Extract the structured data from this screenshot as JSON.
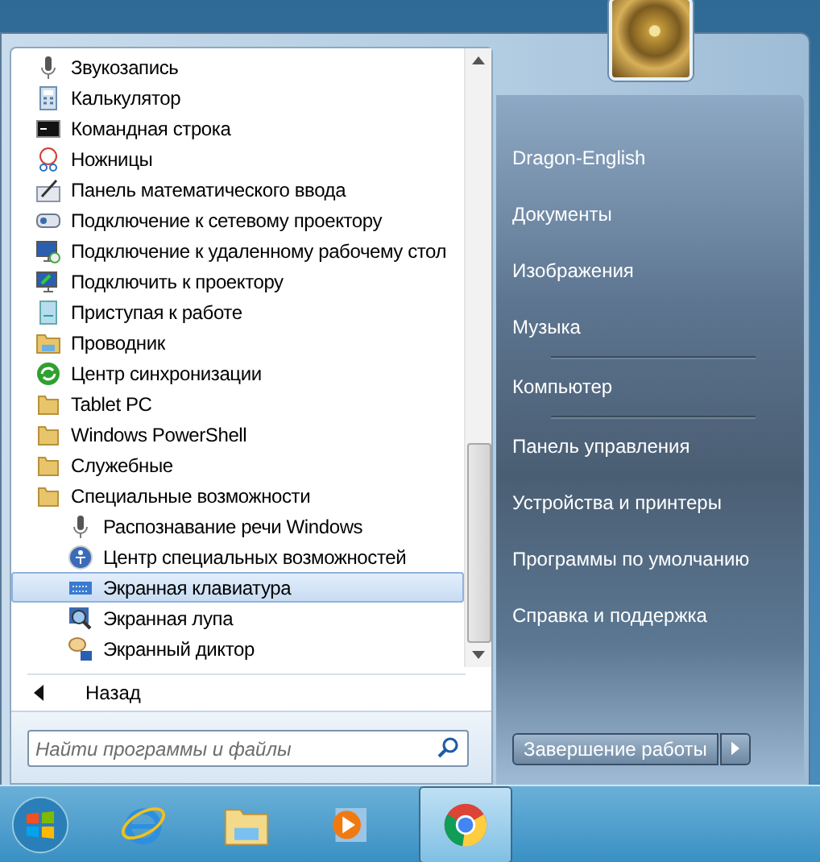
{
  "programs": [
    {
      "label": "Звукозапись",
      "kind": "app",
      "selected": false
    },
    {
      "label": "Калькулятор",
      "kind": "app",
      "selected": false
    },
    {
      "label": "Командная строка",
      "kind": "app",
      "selected": false
    },
    {
      "label": "Ножницы",
      "kind": "app",
      "selected": false
    },
    {
      "label": "Панель математического ввода",
      "kind": "app",
      "selected": false
    },
    {
      "label": "Подключение к сетевому проектору",
      "kind": "app",
      "selected": false
    },
    {
      "label": "Подключение к удаленному рабочему стол",
      "kind": "app",
      "selected": false
    },
    {
      "label": "Подключить к проектору",
      "kind": "app",
      "selected": false
    },
    {
      "label": "Приступая к работе",
      "kind": "app",
      "selected": false
    },
    {
      "label": "Проводник",
      "kind": "app",
      "selected": false
    },
    {
      "label": "Центр синхронизации",
      "kind": "app",
      "selected": false
    },
    {
      "label": "Tablet PC",
      "kind": "folder",
      "selected": false
    },
    {
      "label": "Windows PowerShell",
      "kind": "folder",
      "selected": false
    },
    {
      "label": "Служебные",
      "kind": "folder",
      "selected": false
    },
    {
      "label": "Специальные возможности",
      "kind": "folder",
      "selected": false,
      "children": [
        {
          "label": "Распознавание речи Windows",
          "kind": "app",
          "selected": false
        },
        {
          "label": "Центр специальных возможностей",
          "kind": "app",
          "selected": false
        },
        {
          "label": "Экранная клавиатура",
          "kind": "app",
          "selected": true
        },
        {
          "label": "Экранная лупа",
          "kind": "app",
          "selected": false
        },
        {
          "label": "Экранный диктор",
          "kind": "app",
          "selected": false
        }
      ]
    }
  ],
  "back": "Назад",
  "search": {
    "placeholder": "Найти программы и файлы"
  },
  "places": [
    {
      "label": "Dragon-English",
      "separator_after": false
    },
    {
      "label": "Документы",
      "separator_after": false
    },
    {
      "label": "Изображения",
      "separator_after": false
    },
    {
      "label": "Музыка",
      "separator_after": true
    },
    {
      "label": "Компьютер",
      "separator_after": true
    },
    {
      "label": "Панель управления",
      "separator_after": false
    },
    {
      "label": "Устройства и принтеры",
      "separator_after": false
    },
    {
      "label": "Программы по умолчанию",
      "separator_after": false
    },
    {
      "label": "Справка и поддержка",
      "separator_after": false
    }
  ],
  "shutdown": "Завершение работы",
  "taskbar": [
    {
      "selected": false
    },
    {
      "selected": false
    },
    {
      "selected": false
    },
    {
      "selected": false
    },
    {
      "selected": true
    }
  ]
}
